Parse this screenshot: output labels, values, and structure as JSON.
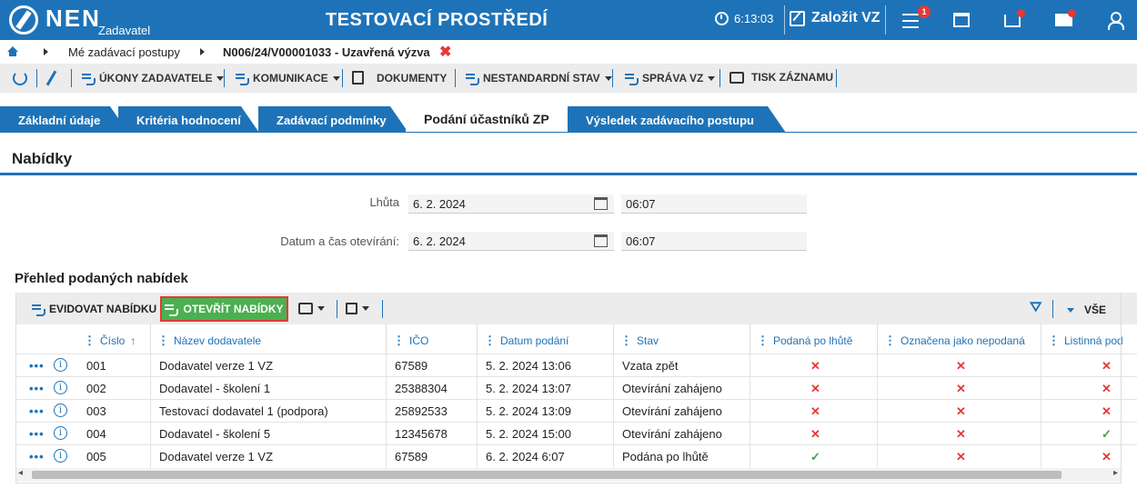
{
  "header": {
    "logo": "NEN",
    "logo_sub": "Zadavatel",
    "title": "TESTOVACÍ PROSTŘEDÍ",
    "time": "6:13:03",
    "zalozit": "Založit VZ",
    "notif_count": "1",
    "accent": "#1e73b8"
  },
  "breadcrumb": {
    "item1": "Mé zadávací postupy",
    "item2": "N006/24/V00001033 - Uzavřená výzva",
    "close": "✖"
  },
  "toolbar": {
    "ukony": "ÚKONY ZADAVATELE",
    "komunikace": "KOMUNIKACE",
    "dokumenty": "DOKUMENTY",
    "nestandardni": "NESTANDARDNÍ STAV",
    "sprava": "SPRÁVA VZ",
    "tisk": "TISK ZÁZNAMU"
  },
  "tabs": [
    "Základní údaje",
    "Kritéria hodnocení",
    "Zadávací podmínky",
    "Podání účastníků ZP",
    "Výsledek zadávacího postupu"
  ],
  "section_title": "Nabídky",
  "form": {
    "lhuta_label": "Lhůta",
    "lhuta_date": "6. 2. 2024",
    "lhuta_time": "06:07",
    "otevirani_label": "Datum a čas otevírání:",
    "otevirani_date": "6. 2. 2024",
    "otevirani_time": "06:07"
  },
  "grid": {
    "title": "Přehled podaných nabídek",
    "evidovat": "EVIDOVAT NABÍDKU",
    "otevrit": "OTEVŘÍT NABÍDKY",
    "vse": "VŠE",
    "columns": {
      "cislo": "Číslo",
      "sort": "↑",
      "nazev": "Název dodavatele",
      "ico": "IČO",
      "datum": "Datum podání",
      "stav": "Stav",
      "po_lhute": "Podaná po lhůtě",
      "nepodana": "Označena jako nepodaná",
      "listinna": "Listinná pod"
    },
    "rows": [
      {
        "cislo": "001",
        "nazev": "Dodavatel verze 1 VZ",
        "ico": "67589",
        "datum": "5. 2. 2024 13:06",
        "stav": "Vzata zpět",
        "po_lhute": "✕",
        "nepodana": "✕",
        "listinna": "✕"
      },
      {
        "cislo": "002",
        "nazev": "Dodavatel - školení 1",
        "ico": "25388304",
        "datum": "5. 2. 2024 13:07",
        "stav": "Otevírání zahájeno",
        "po_lhute": "✕",
        "nepodana": "✕",
        "listinna": "✕"
      },
      {
        "cislo": "003",
        "nazev": "Testovací dodavatel 1 (podpora)",
        "ico": "25892533",
        "datum": "5. 2. 2024 13:09",
        "stav": "Otevírání zahájeno",
        "po_lhute": "✕",
        "nepodana": "✕",
        "listinna": "✕"
      },
      {
        "cislo": "004",
        "nazev": "Dodavatel - školení 5",
        "ico": "12345678",
        "datum": "5. 2. 2024 15:00",
        "stav": "Otevírání zahájeno",
        "po_lhute": "✕",
        "nepodana": "✕",
        "listinna": "✓"
      },
      {
        "cislo": "005",
        "nazev": "Dodavatel verze 1 VZ",
        "ico": "67589",
        "datum": "6. 2. 2024 6:07",
        "stav": "Podána po lhůtě",
        "po_lhute": "✓",
        "nepodana": "✕",
        "listinna": "✕"
      }
    ]
  },
  "icons": {
    "dots": "•••",
    "info": "i",
    "scroll_left": "◂",
    "scroll_right": "▸",
    "filter": "⛛",
    "col_menu": "⋮"
  }
}
